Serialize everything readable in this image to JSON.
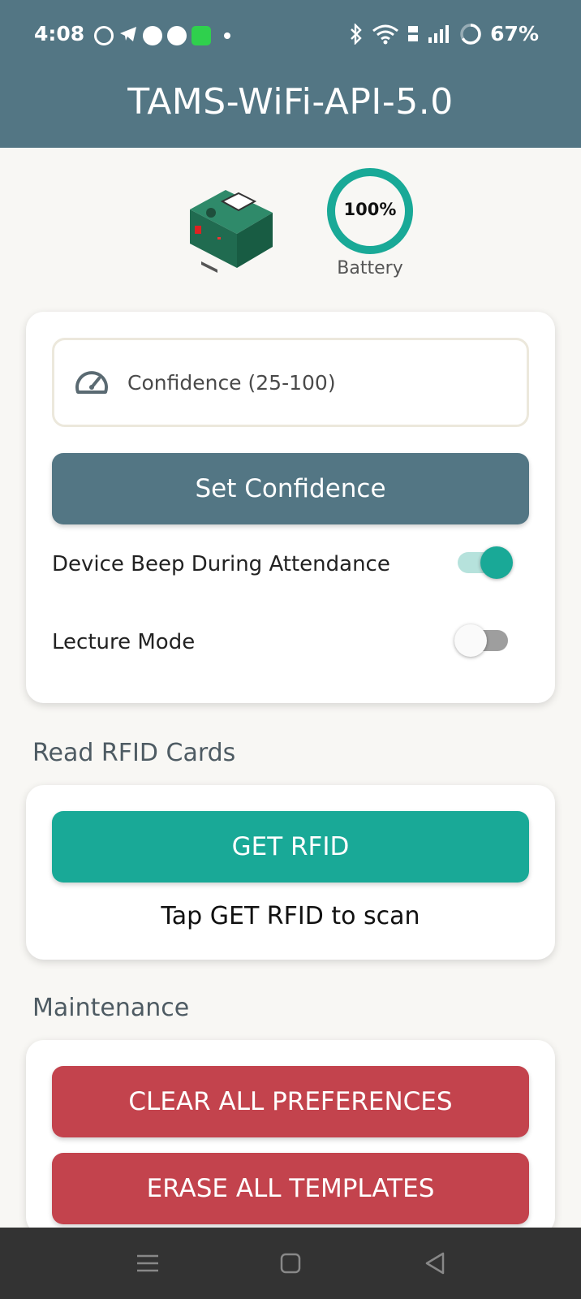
{
  "status_bar": {
    "time": "4:08",
    "battery_text": "67%",
    "notification_icons": [
      "whatsapp-icon",
      "telegram-icon",
      "messages-icon",
      "chat-icon",
      "app-icon"
    ],
    "system_icons": [
      "bluetooth-icon",
      "wifi-icon",
      "volte-icon",
      "signal-icon",
      "battery-ring-icon"
    ]
  },
  "app_bar": {
    "title": "TAMS-WiFi-API-5.0"
  },
  "device_status": {
    "battery_percent_text": "100%",
    "battery_level": 1.0,
    "battery_label": "Battery",
    "accent": "#19a997"
  },
  "settings": {
    "confidence_placeholder": "Confidence (25-100)",
    "set_confidence_label": "Set Confidence",
    "beep_label": "Device Beep During Attendance",
    "beep_on": true,
    "lecture_mode_label": "Lecture Mode",
    "lecture_mode_on": false
  },
  "rfid": {
    "section_title": "Read RFID Cards",
    "button_label": "GET RFID",
    "hint": "Tap GET RFID to scan"
  },
  "maintenance": {
    "section_title": "Maintenance",
    "clear_label": "CLEAR ALL PREFERENCES",
    "erase_label": "ERASE ALL TEMPLATES"
  },
  "colors": {
    "primary": "#537684",
    "accent": "#19a997",
    "danger": "#c3434d",
    "background": "#f8f7f4"
  },
  "nav_bar": {
    "icons": [
      "menu-icon",
      "home-icon",
      "back-icon"
    ]
  }
}
